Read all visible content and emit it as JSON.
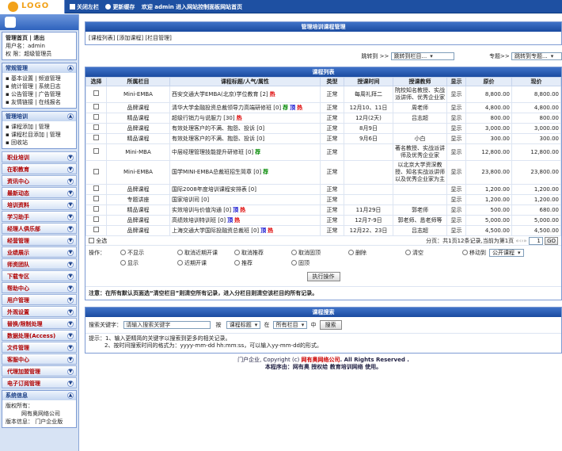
{
  "logo": "LOGO",
  "topnav": {
    "close_left": "关闭左栏",
    "update_cache": "更新缓存",
    "welcome": "欢迎 admin 进入网站控制面板网站首页"
  },
  "sidebar": {
    "panel1": {
      "links": "管理首页 | 退出",
      "user": "用户名：admin",
      "role": "权  限：超级管理员"
    },
    "regular": {
      "title": "常规管理",
      "items": [
        "▪ 基本设置 | 频道管理",
        "▪ 统计管理 | 系统日志",
        "▪ 公告管理 | 广告管理",
        "▪ 友情链接 | 在线报名"
      ]
    },
    "training": {
      "title": "管理培训",
      "items": [
        "▪ 课程添加 | 管理",
        "▪ 课程栏目添加 | 管理",
        "▪ 回收站"
      ]
    },
    "menu": [
      "职业培训",
      "在职教育",
      "资讯中心",
      "最新动态",
      "培训资料",
      "学习助手",
      "经理人俱乐部",
      "经营管理",
      "业绩展示",
      "师资团队",
      "下载专区",
      "帮助中心",
      "用户管理",
      "外观设置",
      "替换/限制处理",
      "数据处理(Access)",
      "文件管理",
      "客服中心",
      "代理加盟管理",
      "电子订阅管理"
    ],
    "sysinfo": {
      "title": "系统信息",
      "copyright": "版权所有：",
      "company": "网有奥网络公司",
      "version": "版本信息：  门户企业版"
    }
  },
  "main": {
    "mgmt": {
      "title": "管理培训课程管理",
      "links": "[课程列表] [添加课程] [栏目管理]"
    },
    "jump": {
      "label1": "跳转到 >>",
      "sel1": "跳转到栏目...",
      "label2": "专题>>",
      "sel2": "跳转到专题..."
    },
    "list": {
      "title": "课程列表",
      "headers": [
        "选择",
        "所属栏目",
        "课程标题/人气/属性",
        "类型",
        "授课时间",
        "授课教师",
        "显示",
        "原价",
        "现价"
      ],
      "rows": [
        {
          "cat": "Mini-EMBA",
          "title": "西安交通大学EMBA(北京)学位教育 [2]",
          "flags": [
            [
              "热",
              "hot"
            ]
          ],
          "type": "正常",
          "time": "每周礼拜二",
          "teacher": "院校知名教授、实战派讲师、优秀企业家",
          "show": "显示",
          "orig": "8,800.00",
          "now": "8,800.00"
        },
        {
          "cat": "品牌课程",
          "title": "清华大学金融投资总裁领导力高端研修班 [0]",
          "flags": [
            [
              "荐",
              "rec"
            ],
            [
              "顶",
              "top"
            ],
            [
              "热",
              "hot"
            ]
          ],
          "type": "正常",
          "time": "12月10、11日",
          "teacher": "周老师",
          "show": "显示",
          "orig": "4,800.00",
          "now": "4,800.00"
        },
        {
          "cat": "精品课程",
          "title": "超级行销力与说服力 [30]",
          "flags": [
            [
              "热",
              "hot"
            ]
          ],
          "type": "正常",
          "time": "12月(2天)",
          "teacher": "吕志超",
          "show": "显示",
          "orig": "800.00",
          "now": "800.00"
        },
        {
          "cat": "品牌课程",
          "title": "有效处理客户的不满、抱怨、投诉 [0]",
          "flags": [],
          "type": "正常",
          "time": "8月9日",
          "teacher": "",
          "show": "显示",
          "orig": "3,000.00",
          "now": "3,000.00"
        },
        {
          "cat": "精品课程",
          "title": "有效处理客户的不满、抱怨、投诉 [0]",
          "flags": [],
          "type": "正常",
          "time": "9月6日",
          "teacher": "小白",
          "show": "显示",
          "orig": "300.00",
          "now": "300.00"
        },
        {
          "cat": "Mini-MBA",
          "title": "中层经理管理技能提升研修班 [0]",
          "flags": [
            [
              "荐",
              "rec"
            ]
          ],
          "type": "正常",
          "time": "",
          "teacher": "著名教授、实战派讲师及优秀企业家",
          "show": "显示",
          "orig": "12,800.00",
          "now": "12,800.00"
        },
        {
          "cat": "Mini-EMBA",
          "title": "国学MINI-EMBA总裁班招生简章 [0]",
          "flags": [
            [
              "荐",
              "rec"
            ]
          ],
          "type": "正常",
          "time": "",
          "teacher": "以北京大学资深教授、知名实战派讲师以及优秀企业家为主",
          "show": "显示",
          "orig": "23,800.00",
          "now": "23,800.00"
        },
        {
          "cat": "品牌课程",
          "title": "国际2008年度培训课程安排表 [0]",
          "flags": [],
          "type": "正常",
          "time": "",
          "teacher": "",
          "show": "显示",
          "orig": "1,200.00",
          "now": "1,200.00"
        },
        {
          "cat": "专题讲座",
          "title": "国家培训司 [0]",
          "flags": [],
          "type": "正常",
          "time": "",
          "teacher": "",
          "show": "显示",
          "orig": "1,200.00",
          "now": "1,200.00"
        },
        {
          "cat": "精品课程",
          "title": "实效培训与价值沟通 [0]",
          "flags": [
            [
              "顶",
              "top"
            ],
            [
              "热",
              "hot"
            ]
          ],
          "type": "正常",
          "time": "11月29日",
          "teacher": "郭老师",
          "show": "显示",
          "orig": "500.00",
          "now": "680.00"
        },
        {
          "cat": "品牌课程",
          "title": "高绩效培训特训班 [0]",
          "flags": [
            [
              "顶",
              "top"
            ],
            [
              "热",
              "hot"
            ]
          ],
          "type": "正常",
          "time": "12月7-9日",
          "teacher": "郭老师、恳老师等",
          "show": "显示",
          "orig": "5,000.00",
          "now": "5,000.00"
        },
        {
          "cat": "品牌课程",
          "title": "上海交通大学国际投融资总裁班 [0]",
          "flags": [
            [
              "顶",
              "top"
            ],
            [
              "热",
              "hot"
            ]
          ],
          "type": "正常",
          "time": "12月22、23日",
          "teacher": "吕志超",
          "show": "显示",
          "orig": "4,500.00",
          "now": "4,500.00"
        }
      ],
      "select_all": "全选",
      "pagination": "分页：共1页12条记录,当前为第1页",
      "page_input": "1",
      "go": "GO",
      "ops_label": "操作：",
      "ops_row1": [
        "不显示",
        "取消近期开课",
        "取消推荐",
        "取消固顶",
        "删除",
        "清空",
        "移动到"
      ],
      "move_sel": "公开课程",
      "ops_row2": [
        "显示",
        "近期开课",
        "推荐",
        "固顶"
      ],
      "exec": "执行操作",
      "note": "注意：在所有默认页面选“清空栏目”则清空所有记录，进入分栏目则清空该栏目的所有记录。"
    },
    "search": {
      "title": "课程搜索",
      "label": "搜索关键字：",
      "placeholder": "请输入搜索关键字",
      "by": "按",
      "field_sel": "课程标题",
      "in": "在",
      "cat_sel": "所有栏目",
      "mid": "中",
      "btn": "搜索",
      "tip1": "提示：1、输入更精简的关键字以搜索到更多的相关记录。",
      "tip2": "2、按时间搜索时间的格式为：yyyy-mm-dd hh:mm:ss，可以输入yy-mm-dd的形式。"
    },
    "footer": {
      "line1a": "门户企业, Copyright (c)",
      "company": "网有奥网络公司",
      "line1b": ". All Rights Reserved .",
      "line2": "本程序由：网有奥 授权给 教育培训网络 使用。"
    }
  }
}
